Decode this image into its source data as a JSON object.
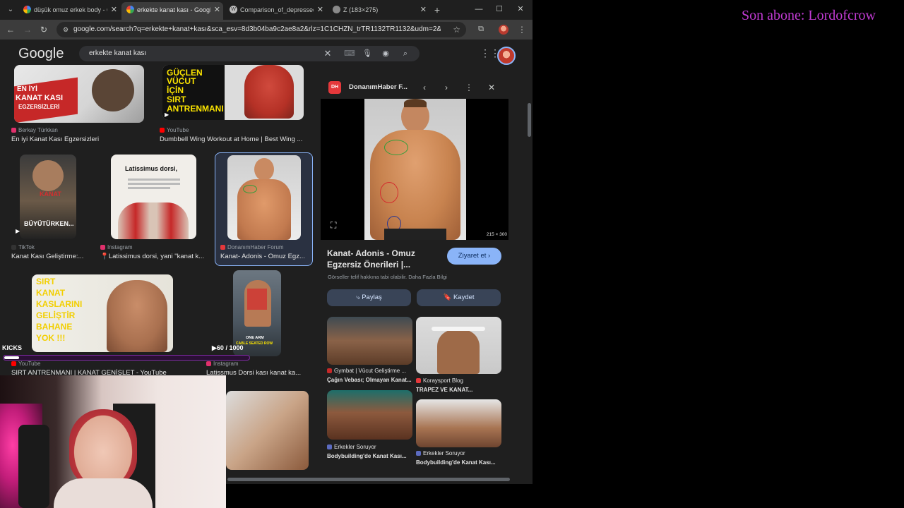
{
  "browser": {
    "tabs": [
      {
        "title": "düşük omuz erkek body - G",
        "favicon": "google",
        "active": false
      },
      {
        "title": "erkekte kanat kası - Google",
        "favicon": "google",
        "active": true
      },
      {
        "title": "Comparison_of_depressed",
        "favicon": "wiki",
        "active": false
      },
      {
        "title": "Z (183×275)",
        "favicon": "globe",
        "active": false
      }
    ],
    "url": "google.com/search?q=erkekte+kanat+kası&sca_esv=8d3b04ba9c2ae8a2&rlz=1C1CHZN_trTR1132TR1132&udm=2&biw=113..."
  },
  "google": {
    "logo": "Google",
    "query": "erkekte kanat kası"
  },
  "results": [
    {
      "source": "Berkay Türkkan",
      "title": "En iyi Kanat Kası Egzersizleri",
      "thumb_text": [
        "EN İYİ",
        "KANAT KASI",
        "EGZERSİZLERİ"
      ],
      "source_color": "#e1306c"
    },
    {
      "source": "YouTube",
      "title": "Dumbbell Wing Workout at Home | Best Wing ...",
      "thumb_text": [
        "GÜÇLEN",
        "VÜCUT",
        "İÇİN",
        "SIRT",
        "ANTRENMANI"
      ],
      "source_color": "#ff0000"
    },
    {
      "source": "TikTok",
      "title": "Kanat Kası Geliştirme:...",
      "thumb_text": [
        "KANAT",
        "BÜYÜTÜRKEN..."
      ],
      "source_color": "#000000"
    },
    {
      "source": "Instagram",
      "title": "📍Latissimus dorsi, yani \"kanat k...",
      "thumb_text": [
        "Latissimus dorsi,"
      ],
      "source_color": "#e1306c"
    },
    {
      "source": "DonanımHaber Forum",
      "title": "Kanat- Adonis - Omuz Egz...",
      "selected": true,
      "source_color": "#e5383b"
    },
    {
      "source": "YouTube",
      "title": "SIRT ANTRENMANI | KANAT GENİŞLET - YouTube",
      "thumb_text": [
        "SIRT",
        "KANAT",
        "KASLARINI",
        "GELİŞTİR",
        "BAHANE",
        "YOK !!!"
      ],
      "source_color": "#ff0000"
    },
    {
      "source": "Instagram",
      "title": "Latissmus Dorsi kası kanat ka...",
      "thumb_text": [
        "ONE ARM",
        "CABLE SEATED ROW"
      ],
      "source_color": "#e1306c"
    }
  ],
  "preview": {
    "source": "DonanımHaber F...",
    "source_icon": "DH",
    "dimensions": "215 × 300",
    "title": "Kanat- Adonis - Omuz Egzersiz Önerileri |...",
    "visit_label": "Ziyaret et",
    "copyright_note": "Görseller telif hakkına tabi olabilir. Daha Fazla Bilgi",
    "share_label": "Paylaş",
    "save_label": "Kaydet",
    "related": [
      {
        "source": "Gymbat | Vücut Geliştirme ...",
        "title": "Çağın Vebası; Olmayan Kanat...",
        "source_color": "#c62828"
      },
      {
        "source": "Koraysport Blog",
        "title": "TRAPEZ VE KANAT...",
        "source_color": "#e5383b"
      },
      {
        "source": "Erkekler Soruyor",
        "title": "Bodybuilding'de Kanat Kası...",
        "source_color": "#5c6bc0"
      },
      {
        "source": "Erkekler Soruyor",
        "title": "Bodybuilding'de Kanat Kası...",
        "source_color": "#5c6bc0"
      }
    ]
  },
  "overlay": {
    "last_subscriber": "Son abone: Lordofcrow",
    "kicks_label": "KICKS",
    "kicks_current": "60",
    "kicks_goal": "/ 1000",
    "kicks_progress": 0.06
  }
}
